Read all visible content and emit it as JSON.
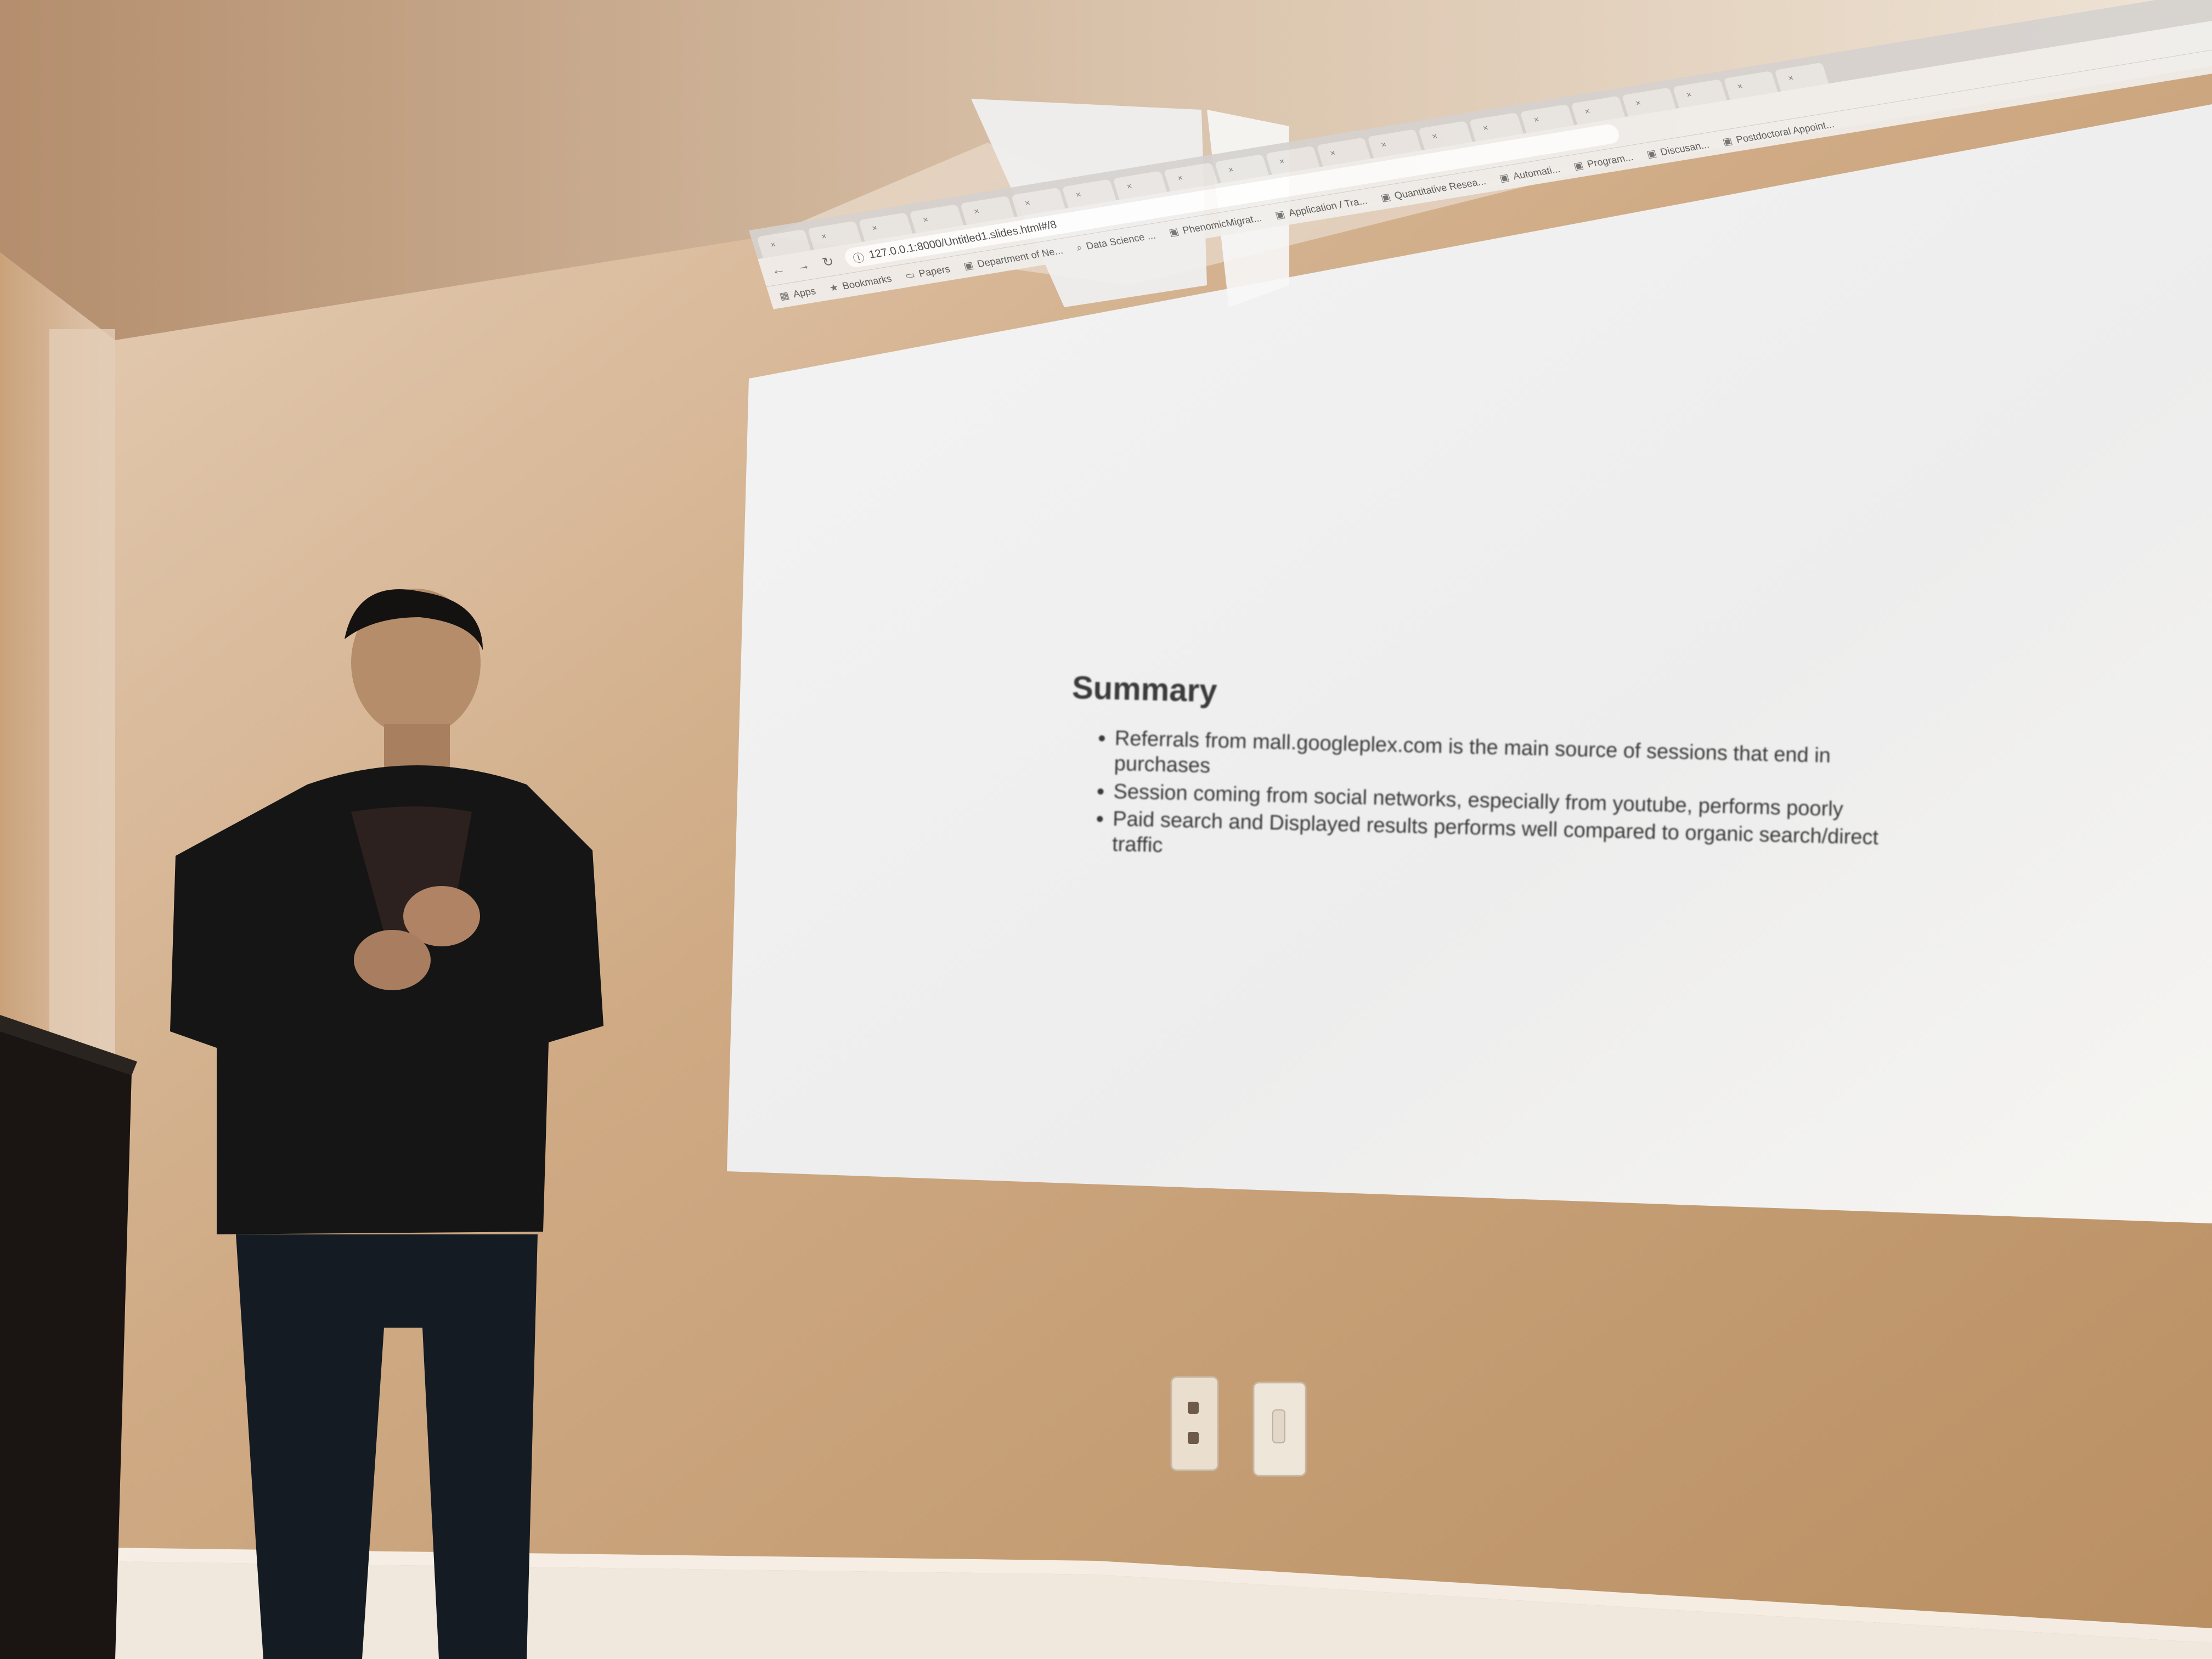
{
  "browser": {
    "tabs": [
      {
        "label": ""
      },
      {
        "label": ""
      },
      {
        "label": ""
      },
      {
        "label": ""
      },
      {
        "label": ""
      },
      {
        "label": ""
      },
      {
        "label": ""
      },
      {
        "label": ""
      },
      {
        "label": ""
      },
      {
        "label": ""
      },
      {
        "label": ""
      },
      {
        "label": ""
      },
      {
        "label": ""
      },
      {
        "label": ""
      },
      {
        "label": ""
      },
      {
        "label": ""
      },
      {
        "label": ""
      },
      {
        "label": ""
      },
      {
        "label": ""
      },
      {
        "label": ""
      },
      {
        "label": ""
      }
    ],
    "address": "127.0.0.1:8000/Untitled1.slides.html#/8",
    "bookmarks": [
      {
        "label": "Apps",
        "icon": "apps-grid-icon"
      },
      {
        "label": "Bookmarks",
        "icon": "star-icon"
      },
      {
        "label": "Papers",
        "icon": "folder-icon"
      },
      {
        "label": "Department of Ne...",
        "icon": "page-icon"
      },
      {
        "label": "Data Science ...",
        "icon": "search-icon"
      },
      {
        "label": "PhenomicMigrat...",
        "icon": "page-icon"
      },
      {
        "label": "Application / Tra...",
        "icon": "page-icon"
      },
      {
        "label": "Quantitative Resea...",
        "icon": "page-icon"
      },
      {
        "label": "Automati...",
        "icon": "page-icon"
      },
      {
        "label": "Program...",
        "icon": "page-icon"
      },
      {
        "label": "Discusan...",
        "icon": "page-icon"
      },
      {
        "label": "Postdoctoral Appoint...",
        "icon": "page-icon"
      }
    ]
  },
  "slide": {
    "title": "Summary",
    "bullets": [
      "Referrals from mall.googleplex.com is the main source of sessions that end in purchases",
      "Session coming from social networks, especially from youtube, performs poorly",
      "Paid search and Displayed results performs well compared to organic search/direct traffic"
    ]
  },
  "colors": {
    "wall": "#bf9a70",
    "screen": "#f2f2f2",
    "speaker_clothes": "#151515",
    "slide_text": "#3a3a3a"
  }
}
